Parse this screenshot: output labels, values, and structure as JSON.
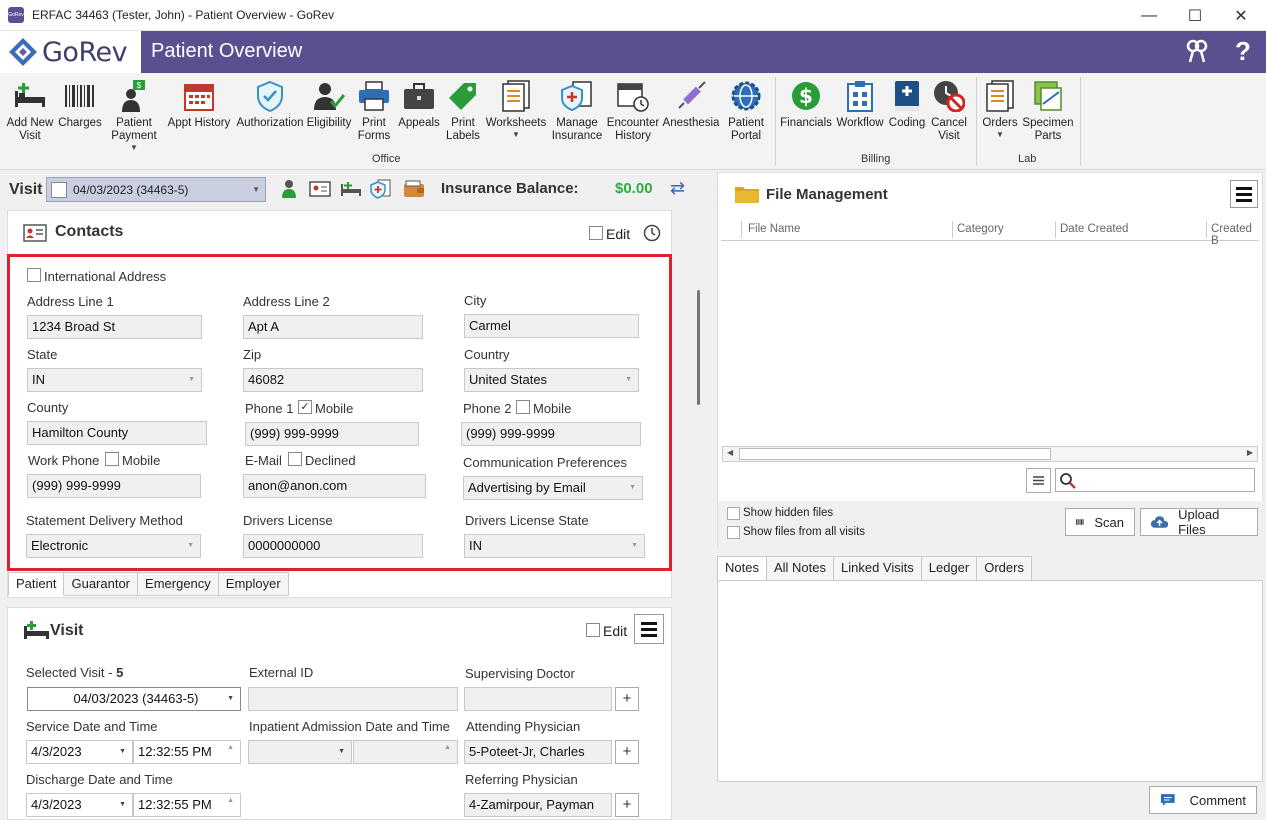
{
  "window": {
    "title": "ERFAC 34463 (Tester, John) - Patient Overview - GoRev",
    "app_icon_text": "GoRev"
  },
  "brand": {
    "logo_text": "GoRev",
    "page_title": "Patient Overview"
  },
  "ribbon": {
    "buttons": {
      "add_new_visit": "Add New\nVisit",
      "charges": "Charges",
      "patient_payment": "Patient\nPayment",
      "appt_history": "Appt History",
      "authorization": "Authorization",
      "eligibility": "Eligibility",
      "print_forms": "Print\nForms",
      "appeals": "Appeals",
      "print_labels": "Print\nLabels",
      "worksheets": "Worksheets",
      "manage_insurance": "Manage\nInsurance",
      "encounter_history": "Encounter\nHistory",
      "anesthesia": "Anesthesia",
      "patient_portal": "Patient\nPortal",
      "financials": "Financials",
      "workflow": "Workflow",
      "coding": "Coding",
      "cancel_visit": "Cancel\nVisit",
      "orders": "Orders",
      "specimen_parts": "Specimen\nParts"
    },
    "groups": {
      "office": "Office",
      "billing": "Billing",
      "lab": "Lab"
    }
  },
  "visit_bar": {
    "label": "Visit",
    "selected": "04/03/2023 (34463-5)",
    "insurance_balance_label": "Insurance Balance:",
    "insurance_balance_value": "$0.00"
  },
  "contacts": {
    "title": "Contacts",
    "edit_label": "Edit",
    "international_address_label": "International Address",
    "fields": {
      "address_line1": {
        "label": "Address Line 1",
        "value": "1234 Broad St"
      },
      "address_line2": {
        "label": "Address Line 2",
        "value": "Apt A"
      },
      "city": {
        "label": "City",
        "value": "Carmel"
      },
      "state": {
        "label": "State",
        "value": "IN"
      },
      "zip": {
        "label": "Zip",
        "value": "46082"
      },
      "country": {
        "label": "Country",
        "value": "United States"
      },
      "county": {
        "label": "County",
        "value": "Hamilton County"
      },
      "phone1": {
        "label": "Phone 1",
        "mobile_label": "Mobile",
        "value": "(999) 999-9999"
      },
      "phone2": {
        "label": "Phone 2",
        "mobile_label": "Mobile",
        "value": "(999) 999-9999"
      },
      "work_phone": {
        "label": "Work Phone",
        "mobile_label": "Mobile",
        "value": "(999) 999-9999"
      },
      "email": {
        "label": "E-Mail",
        "declined_label": "Declined",
        "value": "anon@anon.com"
      },
      "comm_pref": {
        "label": "Communication Preferences",
        "value": "Advertising by Email"
      },
      "statement_delivery": {
        "label": "Statement Delivery Method",
        "value": "Electronic"
      },
      "drivers_license": {
        "label": "Drivers License",
        "value": "0000000000"
      },
      "drivers_license_state": {
        "label": "Drivers License State",
        "value": "IN"
      }
    },
    "tabs": [
      "Patient",
      "Guarantor",
      "Emergency",
      "Employer"
    ]
  },
  "visit_panel": {
    "title": "Visit",
    "edit_label": "Edit",
    "selected_visit_label": "Selected Visit -",
    "selected_visit_count": "5",
    "selected_visit_value": "04/03/2023 (34463-5)",
    "external_id_label": "External ID",
    "supervising_doctor_label": "Supervising Doctor",
    "service_datetime_label": "Service Date and Time",
    "service_date": "4/3/2023",
    "service_time": "12:32:55 PM",
    "inpatient_label": "Inpatient Admission Date and Time",
    "attending_label": "Attending Physician",
    "attending_value": "5-Poteet-Jr, Charles",
    "discharge_label": "Discharge Date and Time",
    "discharge_date": "4/3/2023",
    "discharge_time": "12:32:55 PM",
    "referring_label": "Referring Physician",
    "referring_value": "4-Zamirpour, Payman"
  },
  "file_management": {
    "title": "File Management",
    "columns": [
      "File Name",
      "Category",
      "Date Created",
      "Created B"
    ],
    "show_hidden_label": "Show hidden files",
    "show_all_visits_label": "Show files from all visits",
    "scan_label": "Scan",
    "upload_label": "Upload Files"
  },
  "notes": {
    "tabs": [
      "Notes",
      "All Notes",
      "Linked Visits",
      "Ledger",
      "Orders"
    ],
    "comment_label": "Comment"
  }
}
